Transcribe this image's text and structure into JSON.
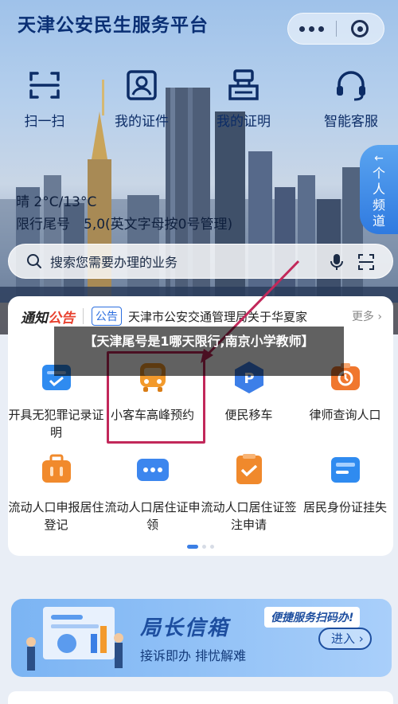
{
  "app_title": "天津公安民生服务平台",
  "quick_entries": [
    {
      "label": "扫一扫",
      "icon": "scan-icon"
    },
    {
      "label": "我的证件",
      "icon": "id-card-icon"
    },
    {
      "label": "我的证明",
      "icon": "certificate-icon"
    },
    {
      "label": "智能客服",
      "icon": "headset-icon"
    }
  ],
  "side_tab": {
    "arrow": "←",
    "lines": [
      "个",
      "人",
      "频",
      "道"
    ]
  },
  "weather": {
    "line1": "晴 2°C/13°C",
    "line2": "限行尾号　5,0(英文字母按0号管理)"
  },
  "search": {
    "placeholder": "搜索您需要办理的业务"
  },
  "notice": {
    "logo_a": "通知",
    "logo_b": "公告",
    "tag": "公告",
    "text": "天津市公安交通管理局关于华夏家",
    "more": "更多 ›"
  },
  "services": [
    {
      "label": "开具无犯罪记录证明",
      "icon": "record-icon",
      "color": "#2f8bf0"
    },
    {
      "label": "小客车高峰预约",
      "icon": "bus-icon",
      "color": "#f39a2c"
    },
    {
      "label": "便民移车",
      "icon": "parking-icon",
      "color": "#3d7fe8"
    },
    {
      "label": "律师查询人口",
      "icon": "lawyer-icon",
      "color": "#f0772e"
    },
    {
      "label": "流动人口申报居住登记",
      "icon": "briefcase-icon",
      "color": "#f18a2c"
    },
    {
      "label": "流动人口居住证申领",
      "icon": "card-icon",
      "color": "#3c86ee"
    },
    {
      "label": "流动人口居住证签注申请",
      "icon": "check-doc-icon",
      "color": "#f0892c"
    },
    {
      "label": "居民身份证挂失",
      "icon": "idcard-loss-icon",
      "color": "#2f8bf0"
    }
  ],
  "caption": "【天津尾号是1哪天限行,南京小学教师】",
  "banner": {
    "title": "局长信箱",
    "subtitle": "接诉即办 排忧解难",
    "tag": "便捷服务扫码办!",
    "button": "进入 ›"
  },
  "page_indicator": {
    "count": 3,
    "active": 0
  }
}
